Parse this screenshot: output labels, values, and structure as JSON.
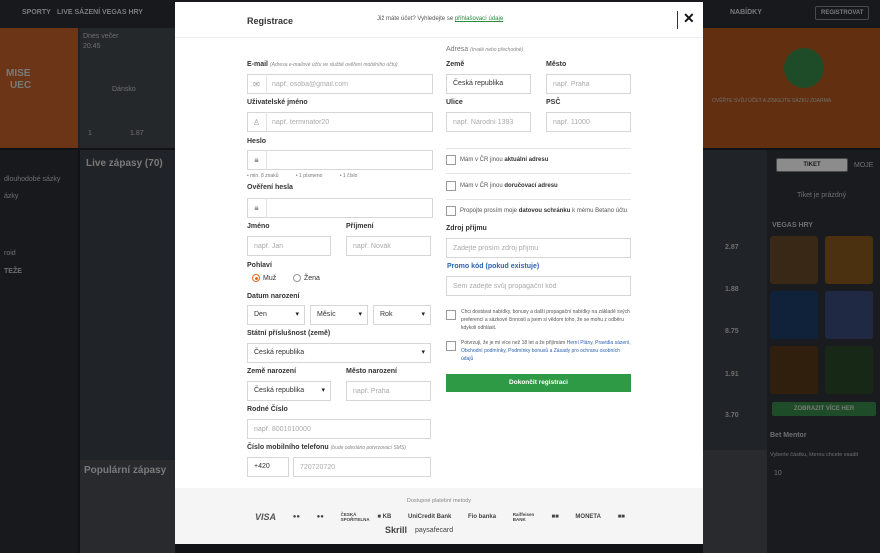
{
  "background": {
    "nav": [
      "SPORTY",
      "LIVE SÁZENÍ",
      "VEGAS HRY"
    ],
    "top_right": [
      "NABÍDKY",
      "REGISTROVAT"
    ],
    "hero_left": [
      "MISE",
      "UEC"
    ],
    "hero_mid": [
      "Dnes večer",
      "20:45",
      "Dánsko"
    ],
    "hero_odds": [
      "1",
      "1.87"
    ],
    "hero_right": "OVĚŘTE SVŮJ ÚČET A ZÍSKEJTE SÁZKU ZDARMA",
    "live_title": "Live zápasy (70)",
    "sidebar": [
      "dlouhodobé sázky",
      "ázky",
      "roid",
      "TEŽE"
    ],
    "popular_title": "Populární zápasy",
    "right_panel": [
      "TIKET",
      "MOJE",
      "Tiket je prázdný",
      "VEGAS HRY",
      "ZOBRAZIT VÍCE HER",
      "Bet Mentor",
      "Vyberte částku, kterou chcete vsadit",
      "10"
    ],
    "odds": [
      "2.87",
      "1.88",
      "8.75",
      "1.91",
      "3.70"
    ]
  },
  "modal": {
    "title": "Registrace",
    "login_prompt": "Již máte účet? Vyhledejte se",
    "login_link": "přihlašovací údaje",
    "close_label": "✕",
    "email": {
      "label": "E-mail",
      "hint": "(Adresa e-mailové účtu ve službě ověření mobilního účtu)",
      "placeholder": "např. osoba@gmail.com"
    },
    "username": {
      "label": "Uživatelské jméno",
      "placeholder": "např. terminator20"
    },
    "password": {
      "label": "Heslo",
      "rules": [
        "min. 8 znaků",
        "1 písmeno",
        "1 číslo"
      ]
    },
    "password_confirm": {
      "label": "Ověření hesla"
    },
    "first_name": {
      "label": "Jméno",
      "placeholder": "např. Jan"
    },
    "last_name": {
      "label": "Příjmení",
      "placeholder": "např. Novák"
    },
    "gender": {
      "label": "Pohlaví",
      "options": [
        "Muž",
        "Žena"
      ],
      "selected": "Muž"
    },
    "birth_date": {
      "label": "Datum narození",
      "day": "Den",
      "month": "Měsíc",
      "year": "Rok"
    },
    "nationality": {
      "label": "Státní příslušnost (země)",
      "value": "Česká republika"
    },
    "birth_country": {
      "label": "Země narození",
      "value": "Česká republika"
    },
    "birth_city": {
      "label": "Město narození",
      "placeholder": "např. Praha"
    },
    "birth_number": {
      "label": "Rodné Číslo",
      "placeholder": "např. 8001010000"
    },
    "phone": {
      "label": "Číslo mobilního telefonu",
      "hint": "(bude odesláno potvrzovací SMS)",
      "prefix": "+420",
      "placeholder": "720720720"
    },
    "address": {
      "label": "Adresa",
      "hint": "(trvalé nebo přechodné)"
    },
    "country": {
      "label": "Země",
      "value": "Česká republika"
    },
    "city": {
      "label": "Město",
      "placeholder": "např. Praha"
    },
    "street": {
      "label": "Ulice",
      "placeholder": "např. Národní 1393"
    },
    "zip": {
      "label": "PSČ",
      "placeholder": "např. 11000"
    },
    "cb_current_address": {
      "pre": "Mám v ČR jinou",
      "bold": "aktuální adresu"
    },
    "cb_mail_address": {
      "pre": "Mám v ČR jinou",
      "bold": "doručovací adresu"
    },
    "cb_databox": {
      "pre": "Propojte prosím moje",
      "bold": "datovou schránku",
      "post": "k mému Betano účtu"
    },
    "income": {
      "label": "Zdroj příjmu",
      "placeholder": "Zadejte prosím zdroj příjmu"
    },
    "promo": {
      "label": "Promo kód (pokud existuje)",
      "placeholder": "Sem zadejte svůj propagační kód"
    },
    "consent_marketing": "Chci dostávat nabídky, bonusy a další propagační nabídky na základě svých preferencí a sázkové činnosti a jsem si vědom toho, že se mohu z odběru kdykoli odhlásit.",
    "consent_terms_pre": "Potvrzuji, že je mi více než 18 let a že přijímám",
    "consent_terms_links": "Herní Plány, Pravidla sázení, Obchodní podmínky, Podmínky bonusů a Zásady pro ochranu osobních údajů",
    "submit_label": "Dokončit registraci",
    "payment_title": "Dostupné platební metody",
    "payment_methods": [
      "VISA",
      "●●",
      "●●",
      "ČESKÁ SPOŘITELNA",
      "■ KB",
      "UniCredit Bank",
      "Fio banka",
      "Raiffeisen BANK",
      "■■",
      "MONETA",
      "■■"
    ],
    "payment_methods_2": [
      "Skrill",
      "paysafecard"
    ]
  }
}
